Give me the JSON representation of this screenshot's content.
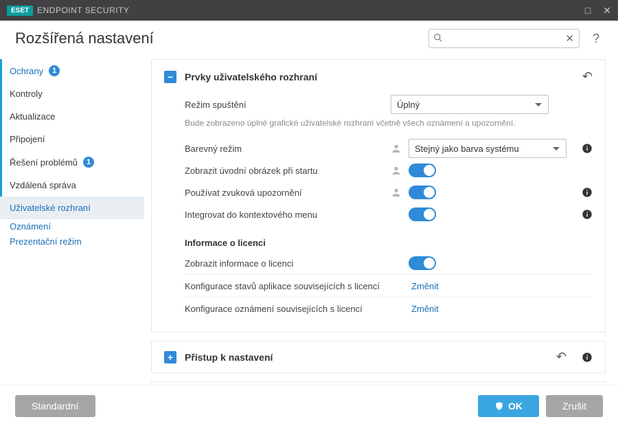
{
  "titlebar": {
    "brand": "ESET",
    "product": "ENDPOINT SECURITY"
  },
  "header": {
    "title": "Rozšířená nastavení",
    "search_placeholder": ""
  },
  "sidebar": {
    "items": [
      {
        "label": "Ochrany",
        "badge": "1"
      },
      {
        "label": "Kontroly"
      },
      {
        "label": "Aktualizace"
      },
      {
        "label": "Připojení"
      },
      {
        "label": "Řešení problémů",
        "badge": "1"
      },
      {
        "label": "Vzdálená správa"
      },
      {
        "label": "Uživatelské rozhraní"
      }
    ],
    "subs": [
      {
        "label": "Oznámení"
      },
      {
        "label": "Prezentační režim"
      }
    ]
  },
  "panel1": {
    "title": "Prvky uživatelského rozhraní",
    "rows": {
      "startup_mode_label": "Režim spuštění",
      "startup_mode_value": "Úplný",
      "startup_mode_hint": "Bude zobrazeno úplné grafické uživatelské rozhraní včetně všech oznámení a upozornění.",
      "color_mode_label": "Barevný režim",
      "color_mode_value": "Stejný jako barva systému",
      "splash_label": "Zobrazit úvodní obrázek při startu",
      "sound_label": "Používat zvuková upozornění",
      "context_label": "Integrovat do kontextového menu"
    },
    "license": {
      "heading": "Informace o licenci",
      "show_label": "Zobrazit informace o licenci",
      "status_cfg_label": "Konfigurace stavů aplikace souvisejících s licencí",
      "notif_cfg_label": "Konfigurace oznámení souvisejících s licencí",
      "change": "Změnit"
    }
  },
  "panel2": {
    "title": "Přístup k nastavení"
  },
  "footer": {
    "default": "Standardní",
    "ok": "OK",
    "cancel": "Zrušit"
  }
}
